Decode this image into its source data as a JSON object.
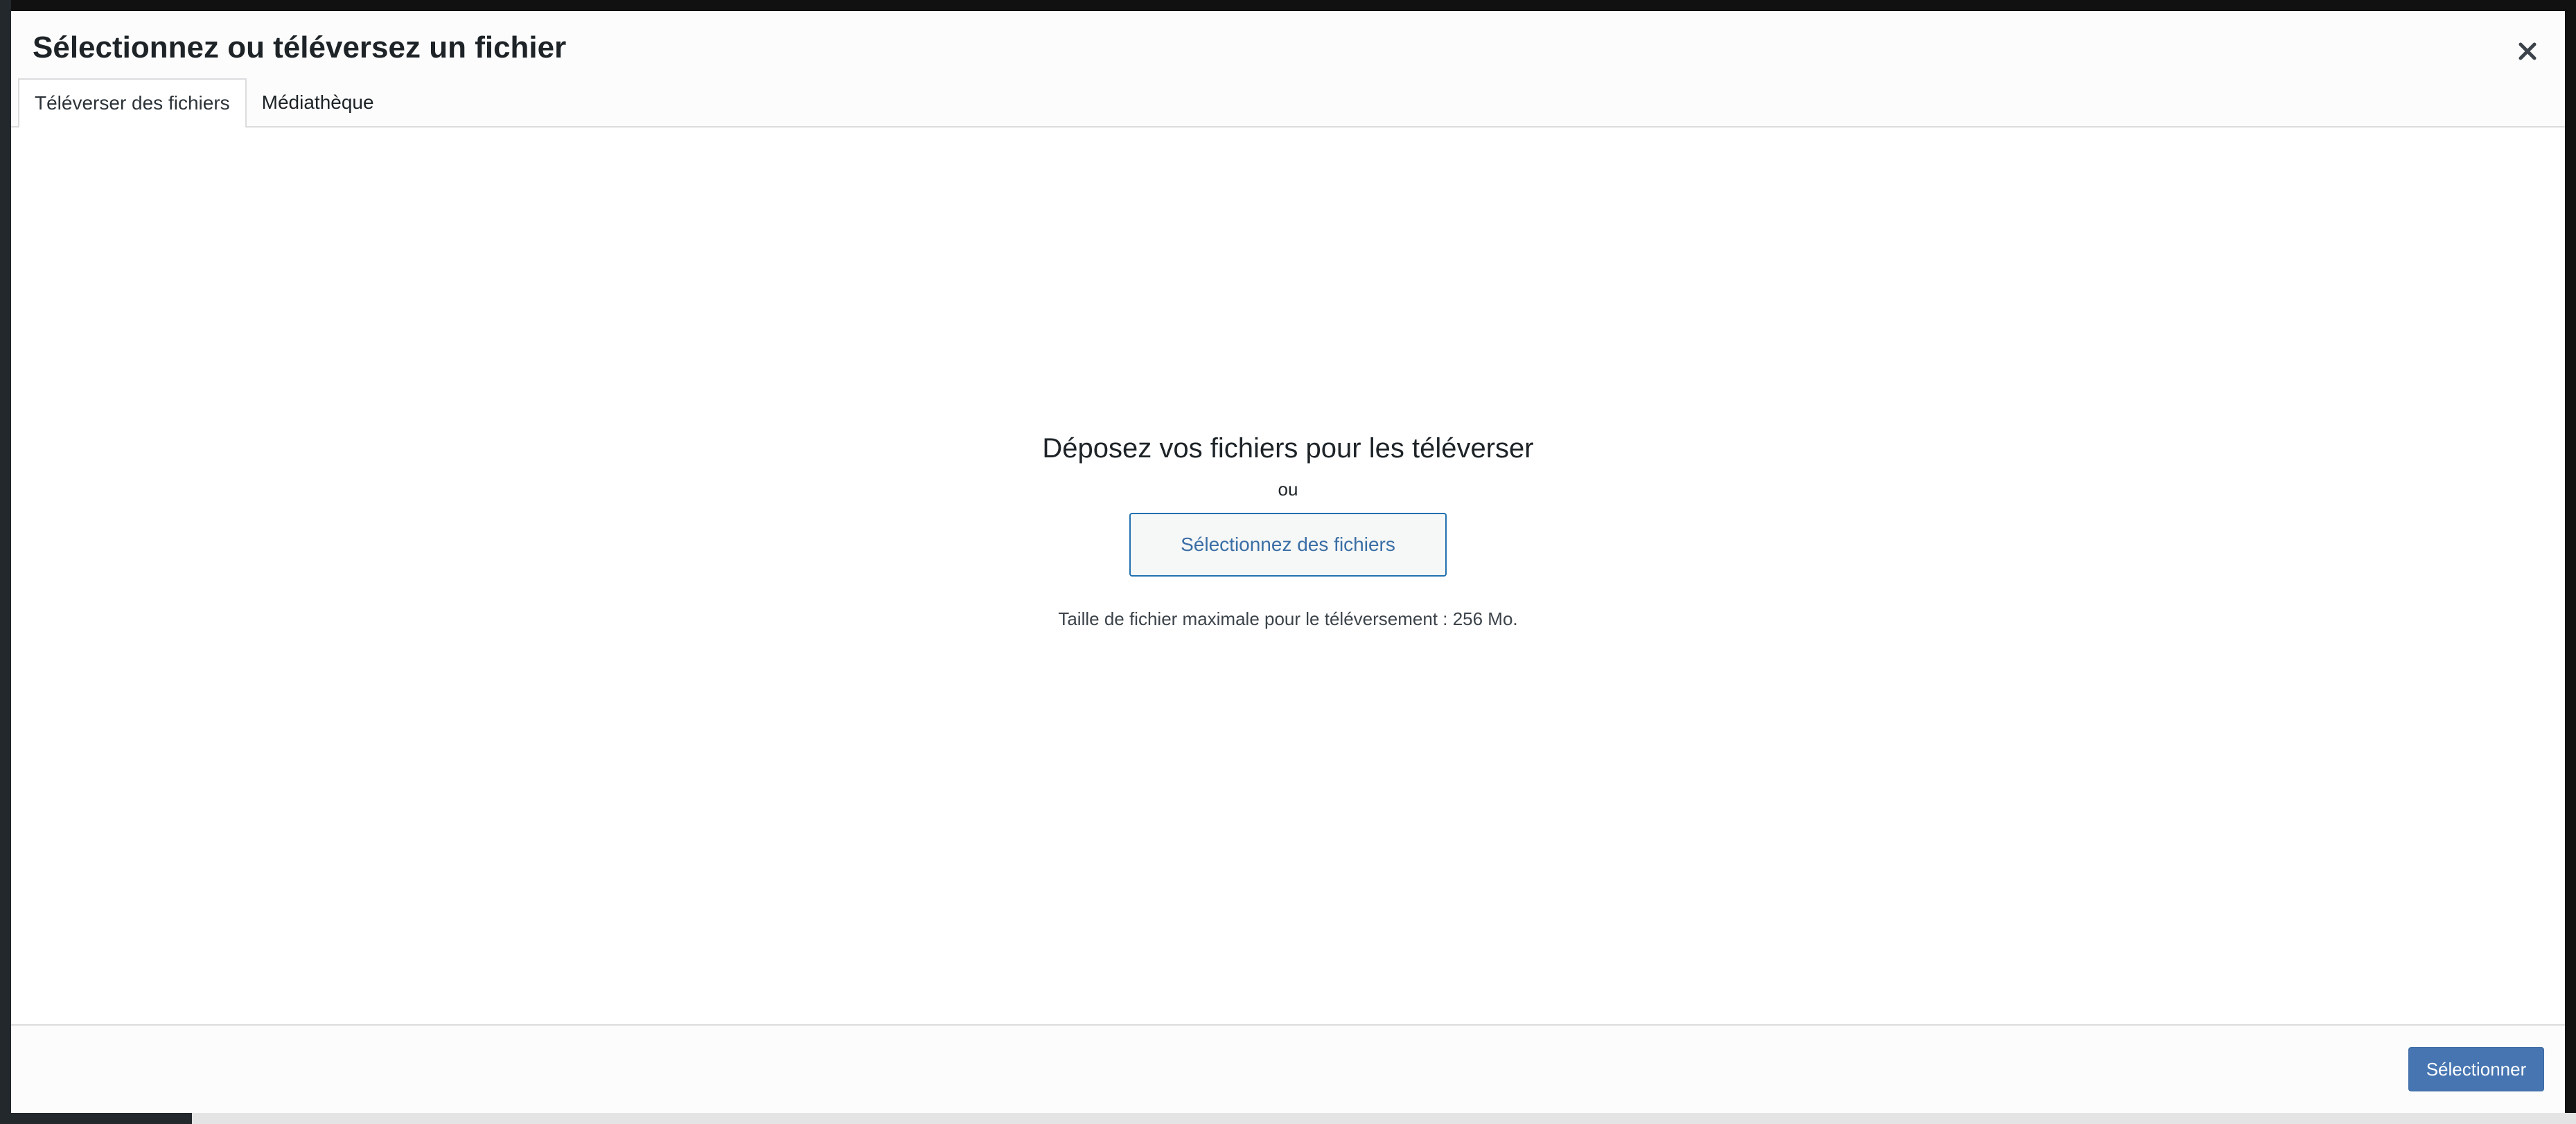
{
  "modal": {
    "title": "Sélectionnez ou téléversez un fichier",
    "close_icon": "close-icon"
  },
  "tabs": [
    {
      "label": "Téléverser des fichiers",
      "active": true
    },
    {
      "label": "Médiathèque",
      "active": false
    }
  ],
  "upload": {
    "instructions": "Déposez vos fichiers pour les téléverser",
    "or": "ou",
    "select_files_label": "Sélectionnez des fichiers",
    "max_size": "Taille de fichier maximale pour le téléversement : 256 Mo."
  },
  "footer": {
    "select_label": "Sélectionner"
  },
  "colors": {
    "primary": "#4675b1",
    "link": "#2271b1",
    "text": "#1d2327",
    "border": "#dcdcde"
  }
}
